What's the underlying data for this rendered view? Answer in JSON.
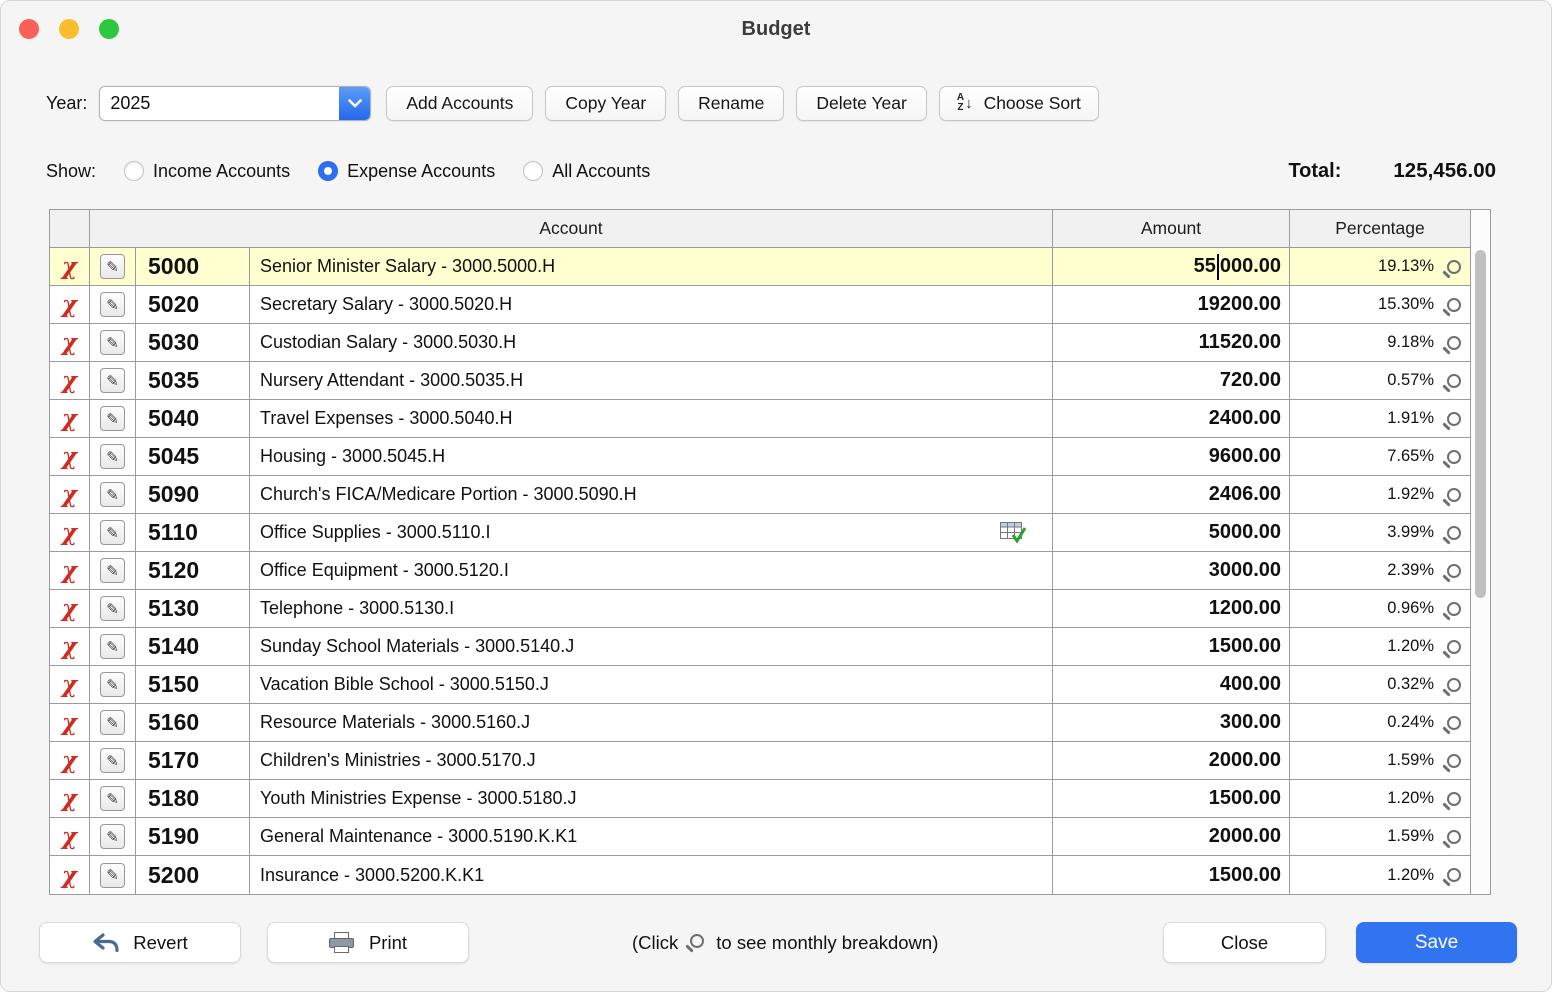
{
  "window": {
    "title": "Budget"
  },
  "icons": {
    "delete": "χ",
    "edit": "✎",
    "sort_a": "A",
    "sort_z": "Z",
    "sort_arrow": "↓"
  },
  "toolbar": {
    "year_label": "Year:",
    "year_value": "2025",
    "buttons": [
      "Add Accounts",
      "Copy Year",
      "Rename",
      "Delete Year"
    ],
    "choose_sort_label": "Choose Sort"
  },
  "show": {
    "label": "Show:",
    "options": [
      {
        "label": "Income Accounts",
        "selected": false
      },
      {
        "label": "Expense Accounts",
        "selected": true
      },
      {
        "label": "All Accounts",
        "selected": false
      }
    ],
    "total_label": "Total:",
    "total_value": "125,456.00"
  },
  "table": {
    "headers": {
      "account": "Account",
      "amount": "Amount",
      "percentage": "Percentage"
    },
    "rows": [
      {
        "number": "5000",
        "name": "Senior Minister Salary - 3000.5000.H",
        "amount": "55000.00",
        "percentage": "19.13%",
        "highlighted": true,
        "caret_index": 2
      },
      {
        "number": "5020",
        "name": "Secretary Salary - 3000.5020.H",
        "amount": "19200.00",
        "percentage": "15.30%"
      },
      {
        "number": "5030",
        "name": "Custodian Salary - 3000.5030.H",
        "amount": "11520.00",
        "percentage": "9.18%"
      },
      {
        "number": "5035",
        "name": "Nursery Attendant - 3000.5035.H",
        "amount": "720.00",
        "percentage": "0.57%"
      },
      {
        "number": "5040",
        "name": "Travel Expenses - 3000.5040.H",
        "amount": "2400.00",
        "percentage": "1.91%"
      },
      {
        "number": "5045",
        "name": "Housing - 3000.5045.H",
        "amount": "9600.00",
        "percentage": "7.65%"
      },
      {
        "number": "5090",
        "name": "Church's FICA/Medicare Portion - 3000.5090.H",
        "amount": "2406.00",
        "percentage": "1.92%"
      },
      {
        "number": "5110",
        "name": "Office Supplies - 3000.5110.I",
        "amount": "5000.00",
        "percentage": "3.99%",
        "grid_icon": true
      },
      {
        "number": "5120",
        "name": "Office Equipment - 3000.5120.I",
        "amount": "3000.00",
        "percentage": "2.39%"
      },
      {
        "number": "5130",
        "name": "Telephone - 3000.5130.I",
        "amount": "1200.00",
        "percentage": "0.96%"
      },
      {
        "number": "5140",
        "name": "Sunday School Materials - 3000.5140.J",
        "amount": "1500.00",
        "percentage": "1.20%"
      },
      {
        "number": "5150",
        "name": "Vacation Bible School - 3000.5150.J",
        "amount": "400.00",
        "percentage": "0.32%"
      },
      {
        "number": "5160",
        "name": "Resource Materials - 3000.5160.J",
        "amount": "300.00",
        "percentage": "0.24%"
      },
      {
        "number": "5170",
        "name": "Children's Ministries - 3000.5170.J",
        "amount": "2000.00",
        "percentage": "1.59%"
      },
      {
        "number": "5180",
        "name": "Youth Ministries Expense - 3000.5180.J",
        "amount": "1500.00",
        "percentage": "1.20%"
      },
      {
        "number": "5190",
        "name": "General Maintenance - 3000.5190.K.K1",
        "amount": "2000.00",
        "percentage": "1.59%"
      },
      {
        "number": "5200",
        "name": "Insurance - 3000.5200.K.K1",
        "amount": "1500.00",
        "percentage": "1.20%"
      }
    ]
  },
  "footer": {
    "revert_label": "Revert",
    "print_label": "Print",
    "hint_before": "(Click",
    "hint_after": "to see monthly breakdown)",
    "close_label": "Close",
    "save_label": "Save"
  },
  "colors": {
    "accent_blue": "#2e6ef2",
    "save_blue": "#3174f1",
    "highlight_row": "#ffffd0",
    "delete_red": "#cf2b20"
  }
}
